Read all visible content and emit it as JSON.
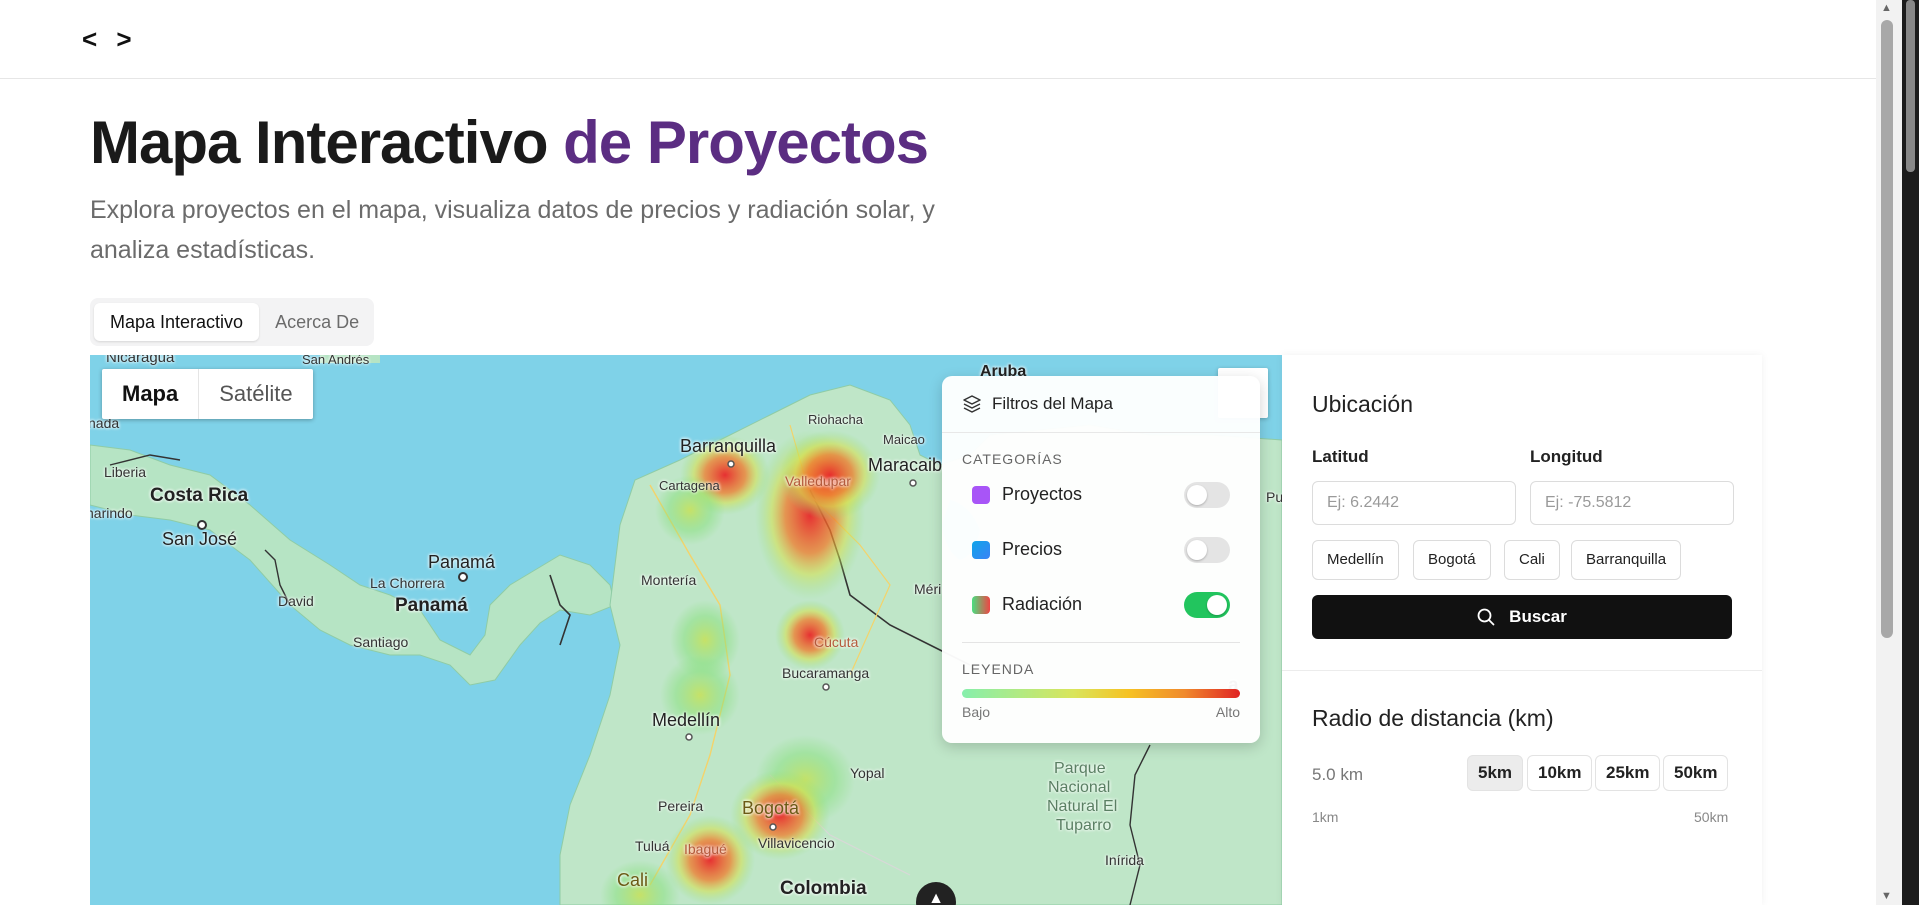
{
  "nav": {
    "back": "<",
    "forward": ">"
  },
  "header": {
    "title_main": "Mapa Interactivo ",
    "title_accent": "de Proyectos",
    "subtitle": "Explora proyectos en el mapa, visualiza datos de precios y radiación solar, y analiza estadísticas."
  },
  "tabs": [
    {
      "label": "Mapa Interactivo",
      "active": true
    },
    {
      "label": "Acerca De",
      "active": false
    }
  ],
  "map": {
    "type_map": "Mapa",
    "type_satellite": "Satélite",
    "labels": {
      "nicaragua": "Nicaragua",
      "san_andres": "San Andrés",
      "aruba": "Aruba",
      "riohacha": "Riohacha",
      "maicao": "Maicao",
      "maracaibo": "Maracaib",
      "barranquilla": "Barranquilla",
      "cartagena": "Cartagena",
      "valledupar": "Valledupar",
      "liberia": "Liberia",
      "costa_rica": "Costa Rica",
      "narino": "narindo",
      "san_jose": "San José",
      "panama_region": "Panamá",
      "la_chorrera": "La Chorrera",
      "panama": "Panamá",
      "david": "David",
      "santiago": "Santiago",
      "monteria": "Montería",
      "cucuta": "Cúcuta",
      "bucaramanga": "Bucaramanga",
      "merida": "Méri",
      "medellin": "Medellín",
      "yopal": "Yopal",
      "pereira": "Pereira",
      "bogota": "Bogotá",
      "tulua": "Tuluá",
      "ibague": "Ibagué",
      "villavicencio": "Villavicencio",
      "cali": "Cali",
      "colombia": "Colombia",
      "parque_1": "Parque",
      "parque_2": "Nacional",
      "parque_3": "Natural El",
      "parque_4": "Tuparro",
      "inirida": "Inírida",
      "nada": "nada",
      "pu": "Pu",
      "a": "a"
    },
    "logo_icon": "map-provider-logo-icon"
  },
  "filters": {
    "title": "Filtros del Mapa",
    "categories_label": "CATEGORÍAS",
    "categories": [
      {
        "name": "Proyectos",
        "color": "#a855f7",
        "enabled": false
      },
      {
        "name": "Precios",
        "color": "#3b82f6",
        "enabled": false
      },
      {
        "name": "Radiación",
        "color": "#e06060",
        "enabled": true
      }
    ],
    "legend_label": "LEYENDA",
    "legend_low": "Bajo",
    "legend_high": "Alto"
  },
  "location": {
    "title": "Ubicación",
    "lat_label": "Latitud",
    "lat_placeholder": "Ej: 6.2442",
    "lng_label": "Longitud",
    "lng_placeholder": "Ej: -75.5812",
    "cities": [
      "Medellín",
      "Bogotá",
      "Cali",
      "Barranquilla"
    ],
    "search_label": "Buscar"
  },
  "radius": {
    "title": "Radio de distancia (km)",
    "value": "5.0 km",
    "options": [
      {
        "label": "5km",
        "selected": true
      },
      {
        "label": "10km",
        "selected": false
      },
      {
        "label": "25km",
        "selected": false
      },
      {
        "label": "50km",
        "selected": false
      }
    ],
    "min_label": "1km",
    "max_label": "50km"
  }
}
